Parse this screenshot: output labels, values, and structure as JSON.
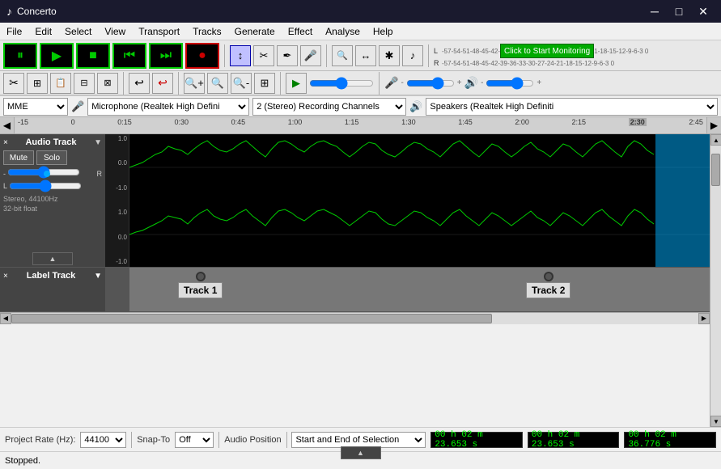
{
  "window": {
    "title": "Concerto",
    "icon": "♪"
  },
  "menu": {
    "items": [
      "File",
      "Edit",
      "Select",
      "View",
      "Transport",
      "Tracks",
      "Generate",
      "Effect",
      "Analyse",
      "Help"
    ]
  },
  "toolbar": {
    "pause_label": "⏸",
    "play_label": "▶",
    "stop_label": "■",
    "prev_label": "⏮",
    "next_label": "⏭",
    "record_label": "●",
    "tools": [
      "↕",
      "✂",
      "✱",
      "🎤"
    ],
    "tools2": [
      "🔍←",
      "↔",
      "✱",
      "🎵"
    ],
    "mixer": {
      "mic_icon": "🎤",
      "speaker_icon": "🔊",
      "gain_label": "",
      "volume_label": ""
    }
  },
  "devices": {
    "interface": "MME",
    "microphone": "Microphone (Realtek High Defini",
    "channels": "2 (Stereo) Recording Channels",
    "output": "Speakers (Realtek High Definiti"
  },
  "timeline": {
    "ticks": [
      {
        "label": "-15",
        "pos": 2
      },
      {
        "label": "0",
        "pos": 8
      },
      {
        "label": "0:15",
        "pos": 14
      },
      {
        "label": "0:30",
        "pos": 20
      },
      {
        "label": "0:45",
        "pos": 26
      },
      {
        "label": "1:00",
        "pos": 32
      },
      {
        "label": "1:15",
        "pos": 38
      },
      {
        "label": "1:30",
        "pos": 44
      },
      {
        "label": "1:45",
        "pos": 50
      },
      {
        "label": "2:00",
        "pos": 56
      },
      {
        "label": "2:15",
        "pos": 62
      },
      {
        "label": "2:30",
        "pos": 68
      },
      {
        "label": "2:45",
        "pos": 74
      }
    ]
  },
  "audio_track": {
    "name": "Audio Track",
    "close_btn": "×",
    "dropdown_btn": "▼",
    "mute_label": "Mute",
    "solo_label": "Solo",
    "info": "Stereo, 44100Hz\n32-bit float",
    "expand_btn": "▲"
  },
  "label_track": {
    "name": "Label Track",
    "close_btn": "×",
    "dropdown_btn": "▼",
    "expand_btn": "▲",
    "labels": [
      {
        "text": "Track 1",
        "pos_pct": 10
      },
      {
        "text": "Track 2",
        "pos_pct": 65
      }
    ]
  },
  "bottom": {
    "project_rate_label": "Project Rate (Hz):",
    "project_rate_value": "44100",
    "snap_to_label": "Snap-To",
    "snap_to_value": "Off",
    "audio_position_label": "Audio Position",
    "selection_mode": "Start and End of Selection",
    "time1": "00 h 02 m 23.653 s",
    "time2": "00 h 02 m 23.653 s",
    "time3": "00 h 02 m 36.776 s"
  },
  "status": {
    "text": "Stopped."
  },
  "vu_meter": {
    "click_to_start": "Click to Start Monitoring",
    "l_label": "L",
    "r_label": "R"
  },
  "colors": {
    "waveform_green": "#00cc00",
    "selection_blue": "#00aacc",
    "bg_dark": "#000000",
    "track_bg": "#444444",
    "label_track_bg": "#888888"
  }
}
